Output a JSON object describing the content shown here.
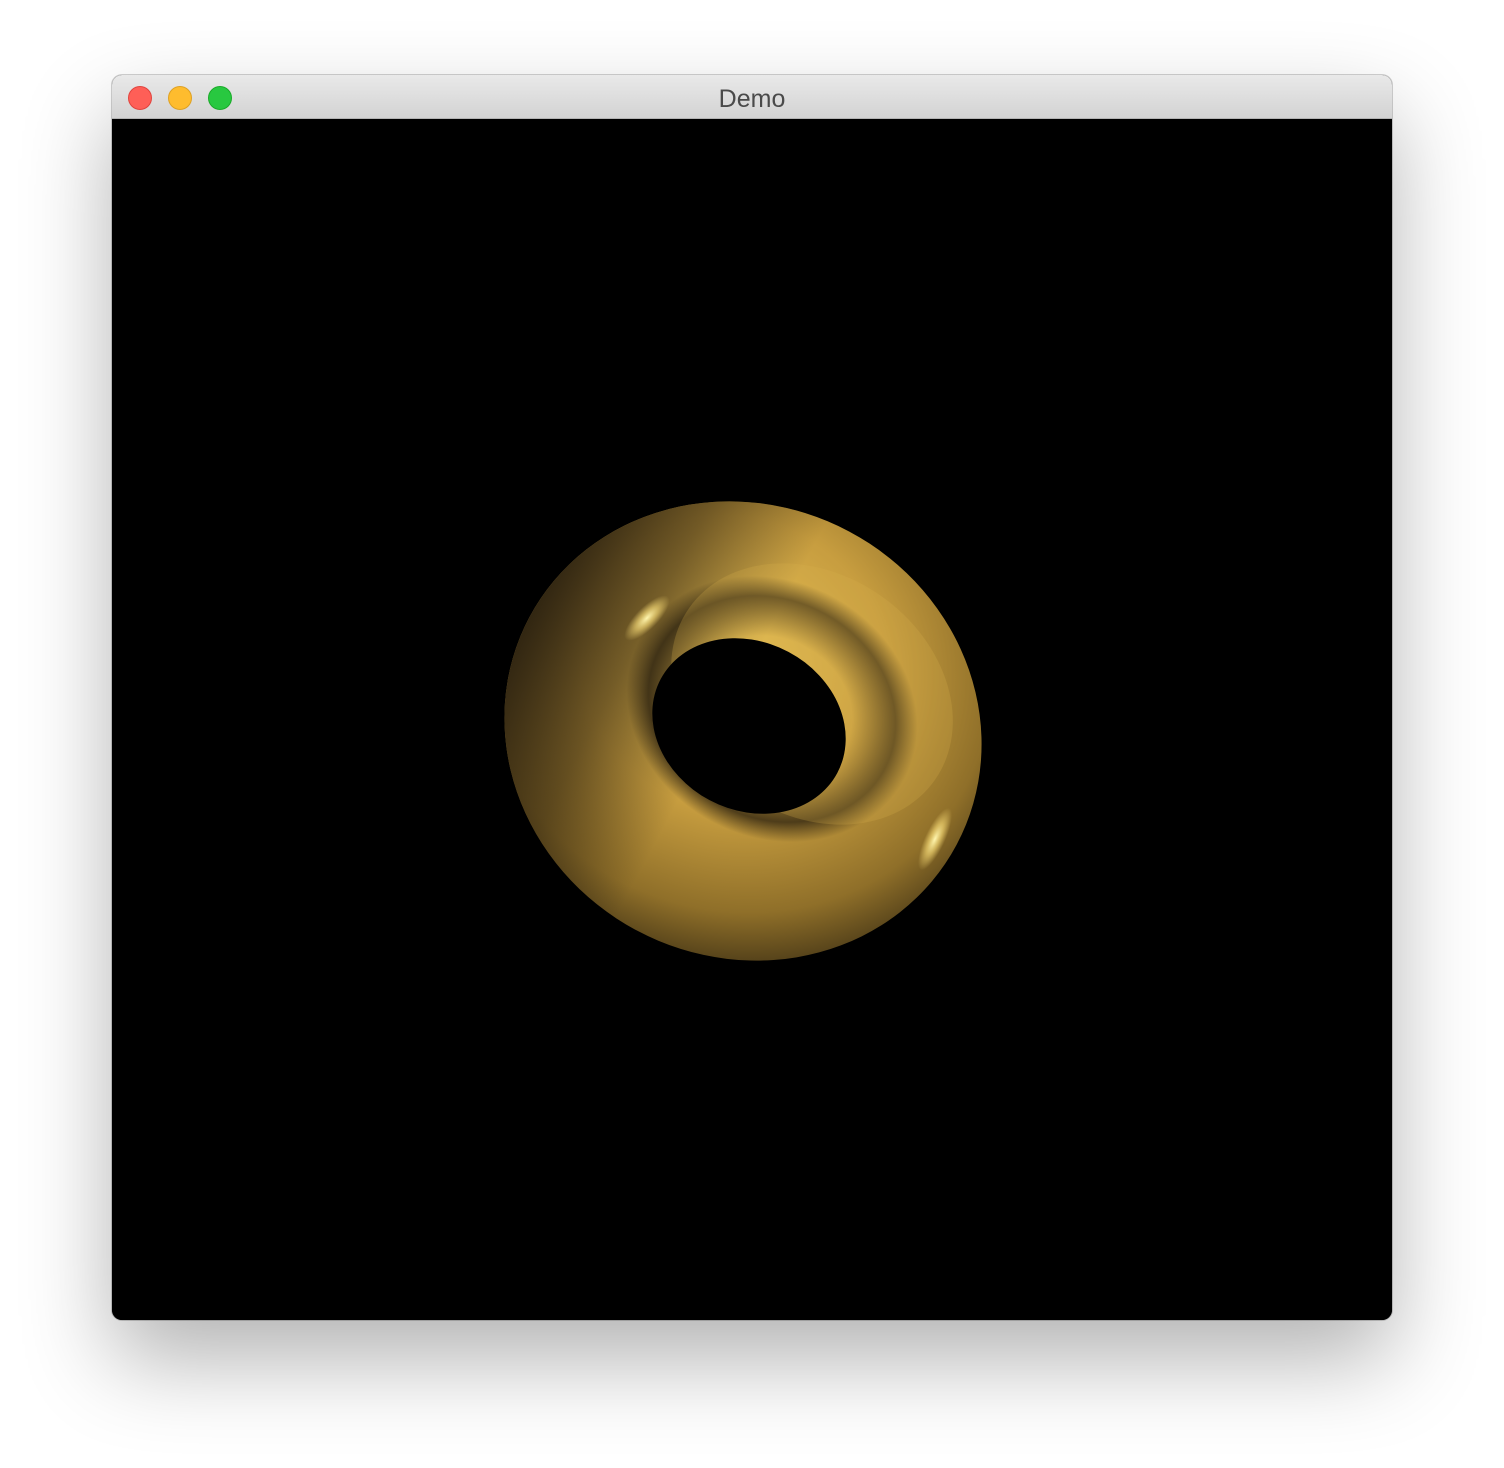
{
  "window": {
    "title": "Demo",
    "buttons": {
      "close": "close-icon",
      "minimize": "minimize-icon",
      "zoom": "zoom-icon"
    }
  },
  "scene": {
    "background": "#000000",
    "object": "torus",
    "color": "#c9a040",
    "highlight": "#fff0a0"
  }
}
